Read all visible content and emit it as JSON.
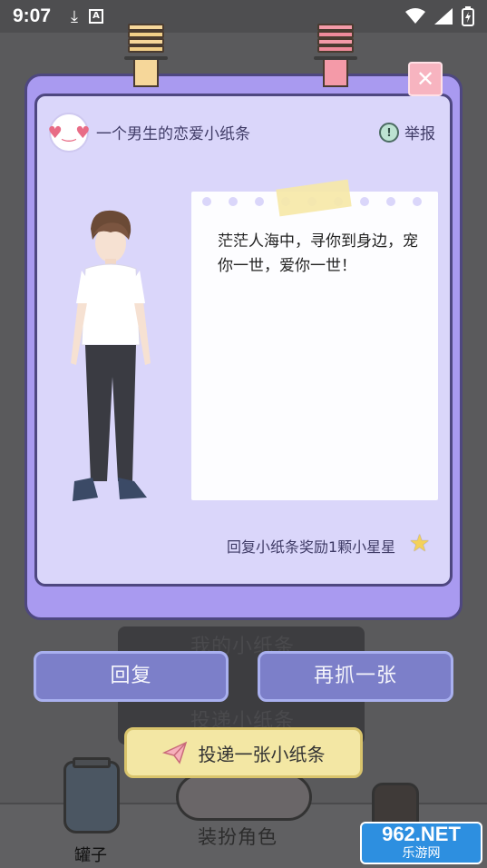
{
  "status": {
    "time": "9:07"
  },
  "card": {
    "title": "一个男生的恋爱小纸条",
    "report_label": "举报",
    "close_label": "✕",
    "note_text": "茫茫人海中，寻你到身边，宠你一世，爱你一世！",
    "reward_text": "回复小纸条奖励1颗小星星"
  },
  "actions": {
    "reply_label": "回复",
    "grab_again_label": "再抓一张",
    "post_label": "投递一张小纸条"
  },
  "background": {
    "my_notes_label": "我的小纸条",
    "post_label": "投递小纸条",
    "jar_label": "罐子",
    "dress_up_label": "装扮角色"
  },
  "watermark": {
    "line1": "962.NET",
    "line2": "乐游网"
  },
  "colors": {
    "card_purple": "#a99af0",
    "button_blue": "#7c7fc9",
    "post_yellow": "#f3e7a4"
  }
}
